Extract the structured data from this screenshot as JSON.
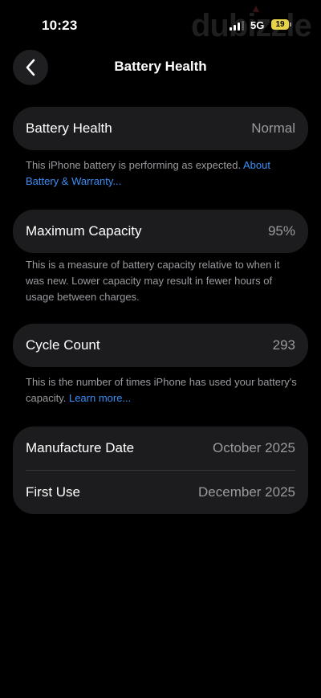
{
  "status_bar": {
    "time": "10:23",
    "network": "5G",
    "battery_level": "19",
    "watermark": "dubizzle"
  },
  "header": {
    "title": "Battery Health",
    "back_icon": "chevron-left-icon"
  },
  "battery_health": {
    "label": "Battery Health",
    "value": "Normal",
    "note": "This iPhone battery is performing as expected.",
    "link": "About Battery & Warranty..."
  },
  "maximum_capacity": {
    "label": "Maximum Capacity",
    "value": "95%",
    "note": "This is a measure of battery capacity relative to when it was new. Lower capacity may result in fewer hours of usage between charges."
  },
  "cycle_count": {
    "label": "Cycle Count",
    "value": "293",
    "note": "This is the number of times iPhone has used your battery's capacity.",
    "link": "Learn more..."
  },
  "dates": {
    "manufacture_label": "Manufacture Date",
    "manufacture_value": "October 2025",
    "first_use_label": "First Use",
    "first_use_value": "December 2025"
  },
  "colors": {
    "background": "#000000",
    "card": "#1c1c1e",
    "link": "#3b8ef5",
    "secondary_text": "#9a9a9f"
  }
}
